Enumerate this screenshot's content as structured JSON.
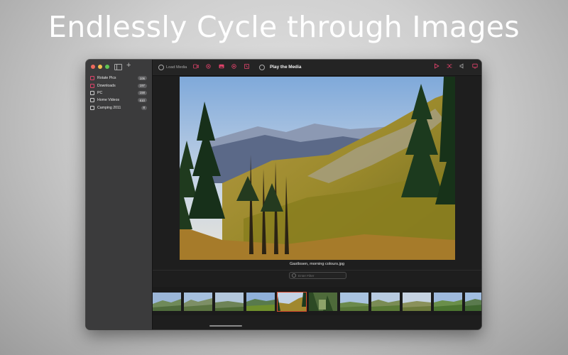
{
  "headline": "Endlessly Cycle through Images",
  "sidebar": {
    "items": [
      {
        "label": "Rotate Pics",
        "count": "106",
        "checked": true
      },
      {
        "label": "Downloads",
        "count": "197",
        "checked": true
      },
      {
        "label": "PC",
        "count": "158",
        "checked": false
      },
      {
        "label": "Home Videos",
        "count": "610",
        "checked": false
      },
      {
        "label": "Camping 2011",
        "count": "8",
        "checked": false
      }
    ]
  },
  "toolbar": {
    "load_label": "Load Media",
    "play_label": "Play the Media"
  },
  "viewer": {
    "caption": "Gastlosen, morning colours.jpg"
  },
  "filter": {
    "placeholder": "Enter Filter"
  },
  "colors": {
    "accent": "#e0426a",
    "selection": "#d84b2b"
  }
}
